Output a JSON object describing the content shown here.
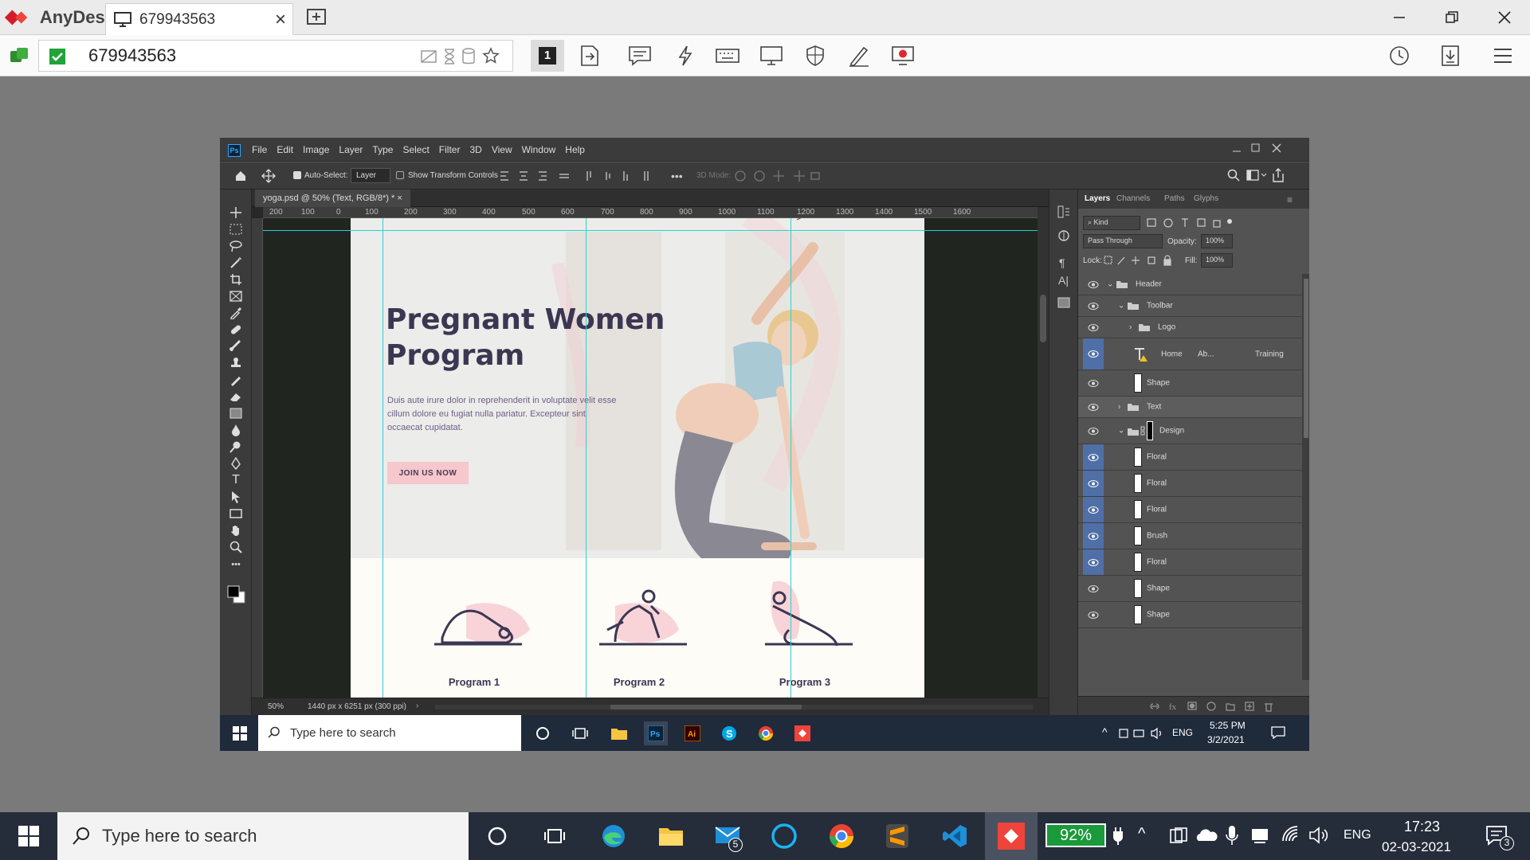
{
  "anydesk": {
    "app_name": "AnyDesk",
    "tab_title": "679943563",
    "address": "679943563",
    "display_badge": "1"
  },
  "photoshop": {
    "logo": "Ps",
    "menus": [
      "File",
      "Edit",
      "Image",
      "Layer",
      "Type",
      "Select",
      "Filter",
      "3D",
      "View",
      "Window",
      "Help"
    ],
    "options": {
      "auto_select": "Auto-Select:",
      "layer_select": "Layer",
      "show_transform": "Show Transform Controls",
      "mode_3d": "3D Mode:"
    },
    "doc_tab": "yoga.psd @ 50% (Text, RGB/8*) *",
    "ruler_ticks": [
      "200",
      "100",
      "0",
      "100",
      "200",
      "300",
      "400",
      "500",
      "600",
      "700",
      "800",
      "900",
      "1000",
      "1100",
      "1200",
      "1300",
      "1400",
      "1500",
      "1600"
    ],
    "status": {
      "zoom": "50%",
      "dimensions": "1440 px x 6251 px (300 ppi)"
    },
    "artboard": {
      "title": "Pregnant Women Program",
      "body": "Duis aute irure dolor in reprehenderit in voluptate velit esse cillum dolore eu fugiat nulla pariatur. Excepteur sint occaecat cupidatat.",
      "cta": "JOIN US NOW",
      "programs": [
        "Program 1",
        "Program 2",
        "Program 3"
      ]
    },
    "layers_panel": {
      "tabs": [
        "Layers",
        "Channels",
        "Paths",
        "Glyphs"
      ],
      "filter": "Kind",
      "blend_mode": "Pass Through",
      "opacity_label": "Opacity:",
      "opacity": "100%",
      "lock_label": "Lock:",
      "fill_label": "Fill:",
      "fill": "100%",
      "text_layer_words": [
        "Home",
        "Ab...",
        "Training"
      ],
      "layers": [
        "Header",
        "Toolbar",
        "Logo",
        "Text",
        "Shape",
        "Text",
        "Design",
        "Floral",
        "Floral",
        "Floral",
        "Brush",
        "Floral",
        "Shape",
        "Shape"
      ]
    }
  },
  "remote_taskbar": {
    "search_placeholder": "Type here to search",
    "lang": "ENG",
    "time": "5:25 PM",
    "date": "3/2/2021"
  },
  "local_taskbar": {
    "search_placeholder": "Type here to search",
    "mail_badge": "5",
    "battery": "92%",
    "lang": "ENG",
    "time": "17:23",
    "date": "02-03-2021",
    "notification_badge": "3"
  }
}
